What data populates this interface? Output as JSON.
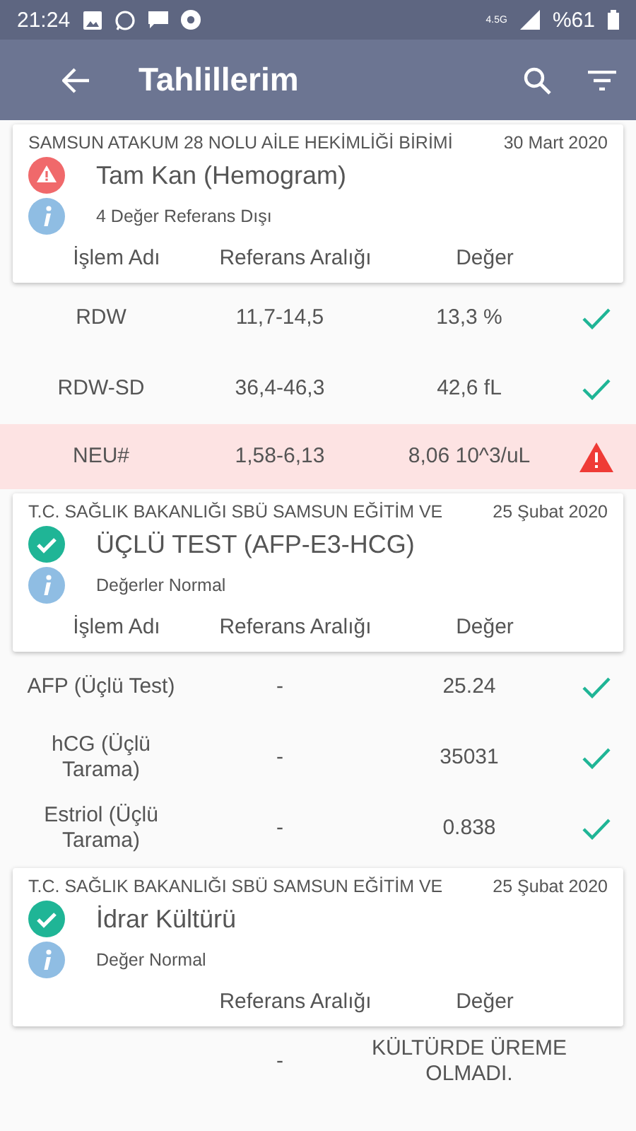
{
  "status_bar": {
    "time": "21:24",
    "network": "4.5G",
    "battery": "%61"
  },
  "app_bar": {
    "title": "Tahlillerim"
  },
  "results": [
    {
      "institution": "SAMSUN ATAKUM 28 NOLU AİLE HEKİMLİĞİ BİRİMİ",
      "date": "30 Mart 2020",
      "test": "Tam Kan (Hemogram)",
      "abnormal": true,
      "info": "4 Değer Referans Dışı",
      "headers": {
        "name": "İşlem Adı",
        "range": "Referans Aralığı",
        "value": "Değer"
      },
      "rows": [
        {
          "name": "RDW",
          "range": "11,7-14,5",
          "value": "13,3 %",
          "out_of_range": false
        },
        {
          "name": "RDW-SD",
          "range": "36,4-46,3",
          "value": "42,6 fL",
          "out_of_range": false
        },
        {
          "name": "NEU#",
          "range": "1,58-6,13",
          "value": "8,06 10^3/uL",
          "out_of_range": true
        }
      ]
    },
    {
      "institution": "T.C. SAĞLIK BAKANLIĞI SBÜ SAMSUN EĞİTİM VE",
      "date": "25 Şubat 2020",
      "test": "ÜÇLÜ TEST (AFP-E3-HCG)",
      "abnormal": false,
      "info": "Değerler Normal",
      "headers": {
        "name": "İşlem Adı",
        "range": "Referans Aralığı",
        "value": "Değer"
      },
      "rows": [
        {
          "name": "AFP (Üçlü Test)",
          "range": "-",
          "value": "25.24",
          "out_of_range": false
        },
        {
          "name": "hCG (Üçlü Tarama)",
          "range": "-",
          "value": "35031",
          "out_of_range": false
        },
        {
          "name": "Estriol (Üçlü Tarama)",
          "range": "-",
          "value": "0.838",
          "out_of_range": false
        }
      ]
    },
    {
      "institution": "T.C. SAĞLIK BAKANLIĞI SBÜ SAMSUN EĞİTİM VE",
      "date": "25 Şubat 2020",
      "test": "İdrar Kültürü",
      "abnormal": false,
      "info": "Değer Normal",
      "headers": {
        "range": "Referans Aralığı",
        "value": "Değer"
      },
      "rows": [
        {
          "range": "-",
          "value": "KÜLTÜRDE ÜREME OLMADI."
        }
      ]
    }
  ]
}
